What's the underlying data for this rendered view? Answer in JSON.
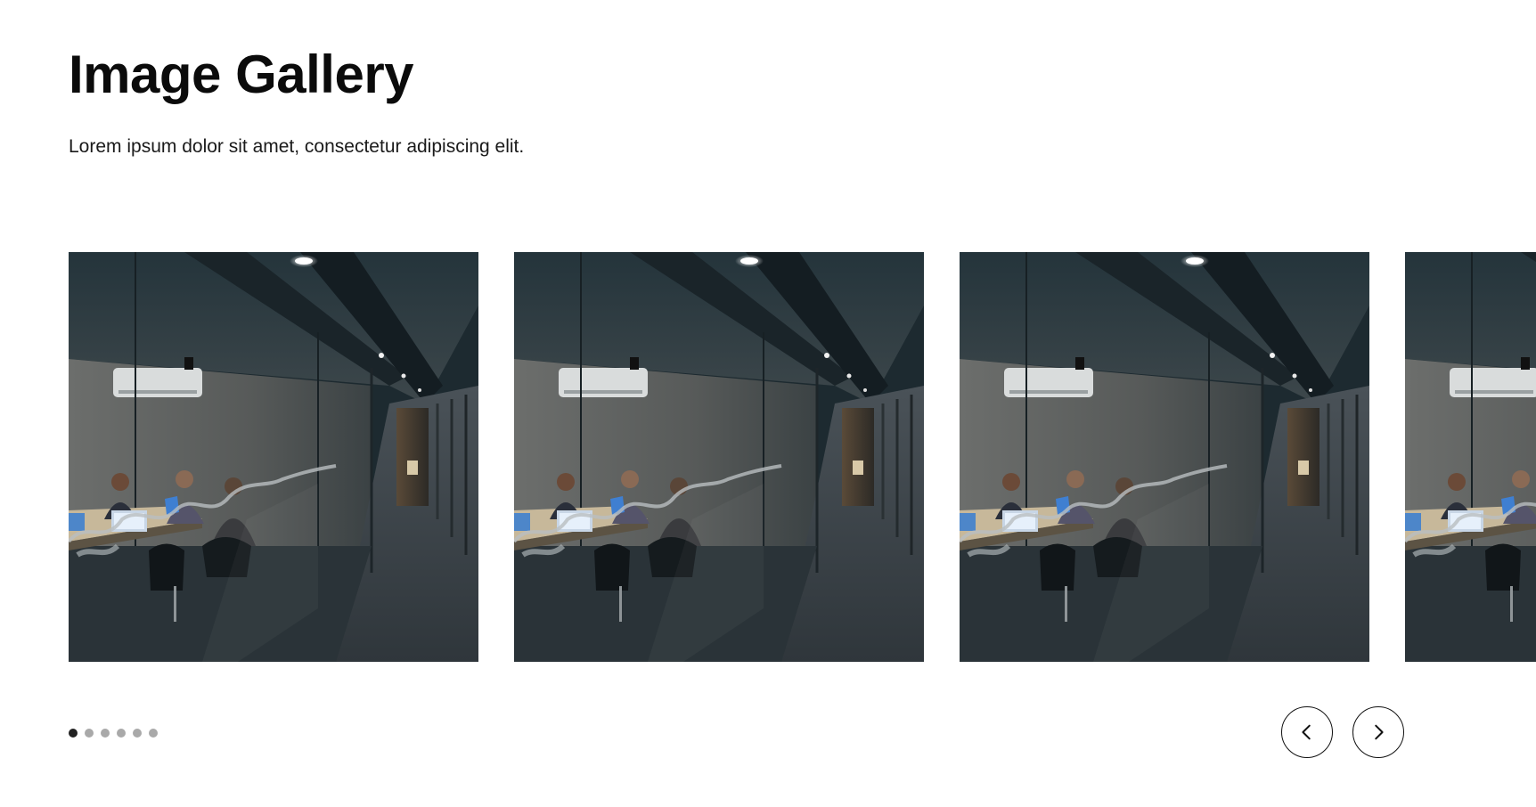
{
  "header": {
    "title": "Image Gallery",
    "subtitle": "Lorem ipsum dolor sit amet, consectetur adipiscing elit."
  },
  "gallery": {
    "slides": [
      {
        "image": "office-meeting-room-photo"
      },
      {
        "image": "office-meeting-room-photo"
      },
      {
        "image": "office-meeting-room-photo"
      },
      {
        "image": "office-meeting-room-photo"
      }
    ],
    "pagination": {
      "total": 6,
      "active": 1
    },
    "controls": {
      "prev_icon": "chevron-left-icon",
      "next_icon": "chevron-right-icon"
    }
  },
  "colors": {
    "dot_active": "#222222",
    "dot_inactive": "#a9a9a9",
    "button_border": "#111111"
  }
}
